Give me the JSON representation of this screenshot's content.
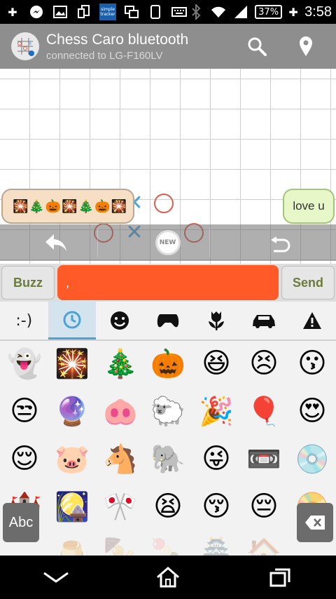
{
  "status_bar": {
    "battery": "37%",
    "time": "3:58",
    "carrier_app_text": "simple tracker"
  },
  "app_bar": {
    "title": "Chess Caro bluetooth",
    "subtitle": "connected to LG-F160LV",
    "search_icon": "search-icon",
    "location_icon": "location-pin-icon"
  },
  "chat": {
    "incoming_emojis": "🎇🎄🎃🎇🎄🎃🎇",
    "outgoing_text": "love u"
  },
  "controls": {
    "new_label": "NEW"
  },
  "input_row": {
    "buzz_label": "Buzz",
    "message_value": ",",
    "send_label": "Send"
  },
  "keyboard": {
    "tabs": [
      ":-)",
      "🕒",
      "😊",
      "🎮",
      "🌷",
      "🚗",
      "▲"
    ],
    "active_tab": 1,
    "abc_label": "Abc",
    "emojis": [
      "👻",
      "🎇",
      "🎄",
      "🎃",
      "😆",
      "😣",
      "😗",
      "😒",
      "🔮",
      "🐽",
      "🐑",
      "🎉",
      "🎈",
      "😍",
      "😌",
      "🐷",
      "🐴",
      "🐘",
      "😜",
      "📼",
      "💿",
      "🏰",
      "🎑",
      "🎌",
      "😫",
      "😚",
      "😔",
      "📀"
    ],
    "faded_emojis": [
      "🍮",
      "🍢",
      "🍡",
      "🏯",
      "🏠"
    ]
  }
}
